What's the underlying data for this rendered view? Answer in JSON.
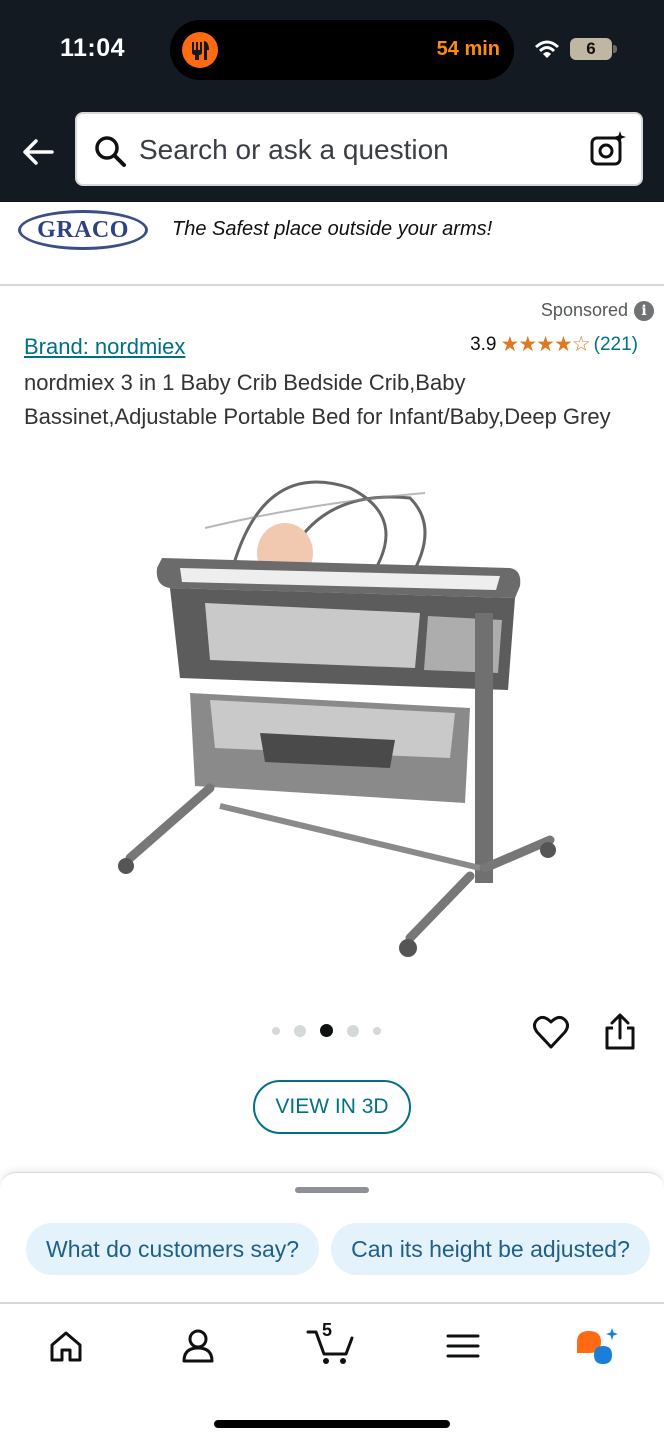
{
  "status_bar": {
    "time": "11:04",
    "live_activity_text": "54 min",
    "battery_level": "6"
  },
  "search": {
    "placeholder": "Search or ask a question"
  },
  "banner": {
    "logo_text": "GRACO",
    "tagline": "The Safest place outside your arms!"
  },
  "product": {
    "sponsored_label": "Sponsored",
    "brand_link": "Brand: nordmiex",
    "rating_value": "3.9",
    "stars": "★★★★☆",
    "rating_count": "(221)",
    "title": "nordmiex 3 in 1 Baby Crib Bedside Crib,Baby Bassinet,Adjustable Portable Bed for Infant/Baby,Deep Grey",
    "image_count": 5,
    "active_image_index": 2,
    "view_3d_label": "VIEW IN 3D"
  },
  "sheet": {
    "chips": [
      "What do customers say?",
      "Can its height be adjusted?"
    ]
  },
  "tabbar": {
    "cart_count": "5",
    "tabs": [
      "home-icon",
      "account-icon",
      "cart-icon",
      "menu-icon",
      "rufus-icon"
    ]
  },
  "colors": {
    "header_bg": "#131a22",
    "link": "#007185",
    "star": "#de7921",
    "chip_bg": "#e3f2fb",
    "live_activity": "#ff6a13"
  }
}
